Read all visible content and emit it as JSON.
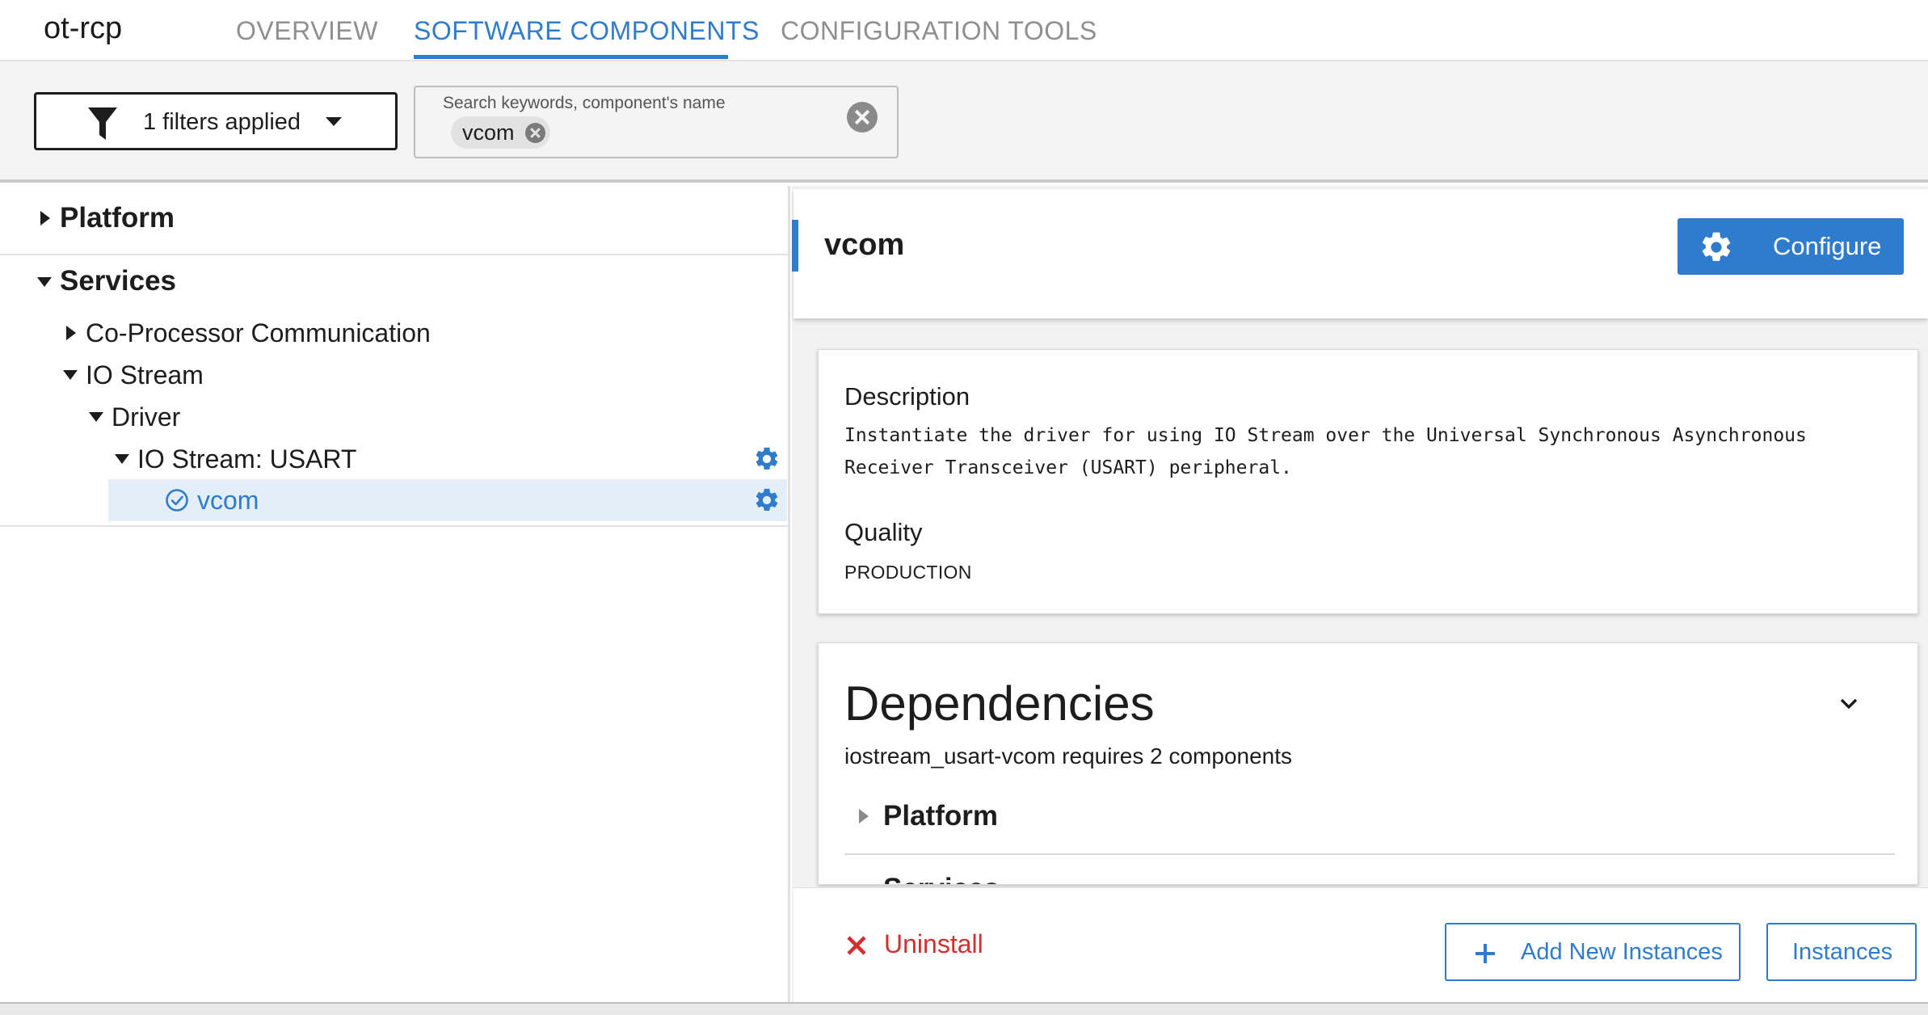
{
  "header": {
    "app_title": "ot-rcp",
    "tabs": [
      {
        "label": "OVERVIEW",
        "active": false
      },
      {
        "label": "SOFTWARE COMPONENTS",
        "active": true
      },
      {
        "label": "CONFIGURATION TOOLS",
        "active": false
      }
    ]
  },
  "toolbar": {
    "filter_label": "1 filters applied",
    "search": {
      "label": "Search keywords, component's name",
      "chip": "vcom"
    }
  },
  "tree": {
    "items": [
      {
        "label": "Platform",
        "expanded": false
      },
      {
        "label": "Services",
        "expanded": true
      },
      {
        "label": "Co-Processor Communication",
        "expanded": false
      },
      {
        "label": "IO Stream",
        "expanded": true
      },
      {
        "label": "Driver",
        "expanded": true
      },
      {
        "label": "IO Stream: USART",
        "expanded": true
      },
      {
        "label": "vcom",
        "selected": true,
        "installed": true
      }
    ]
  },
  "detail": {
    "title": "vcom",
    "configure_label": "Configure",
    "description_heading": "Description",
    "description_line1": "Instantiate the driver for using IO Stream over the Universal Synchronous Asynchronous",
    "description_line2": "Receiver Transceiver (USART) peripheral.",
    "quality_heading": "Quality",
    "quality_value": "PRODUCTION"
  },
  "dependencies": {
    "title": "Dependencies",
    "summary": "iostream_usart-vcom requires 2 components",
    "groups": [
      "Platform",
      "Services"
    ]
  },
  "actions": {
    "uninstall_label": "Uninstall",
    "add_instances_label": "Add New Instances",
    "instances_label": "Instances"
  },
  "colors": {
    "accent": "#2f7ccc",
    "danger": "#d32f2f",
    "selected_row": "#e3eef8"
  }
}
